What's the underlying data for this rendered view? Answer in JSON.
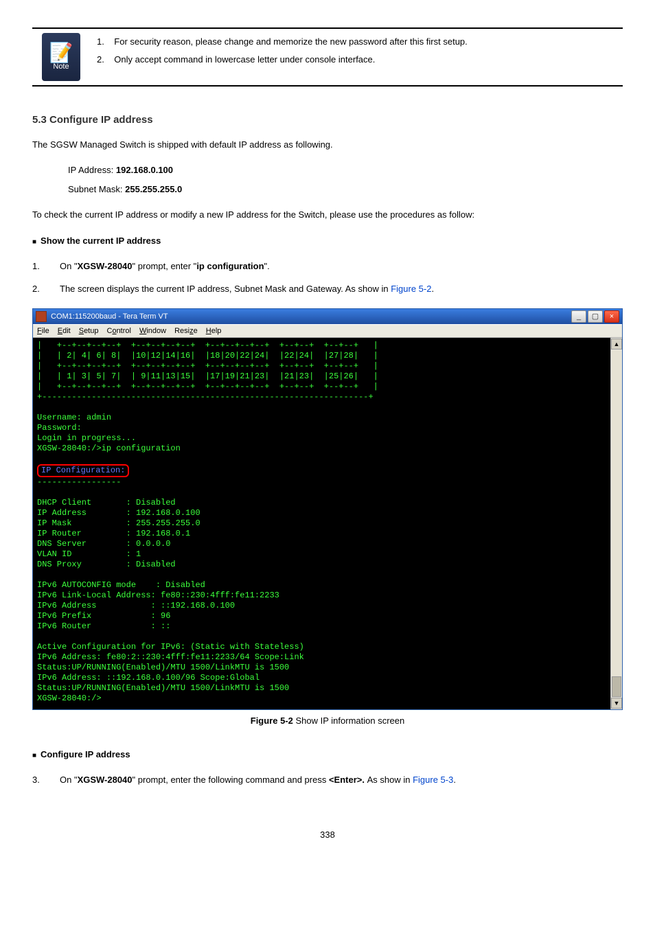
{
  "note": {
    "label": "Note",
    "item1_num": "1.",
    "item1_text": "For security reason, please change and memorize the new password after this first setup.",
    "item2_num": "2.",
    "item2_text": "Only accept command in lowercase letter under console interface."
  },
  "section1_title": "5.3 Configure IP address",
  "para1": "The SGSW Managed Switch is shipped with default IP address as following.",
  "ip_label": "IP Address:",
  "ip_value": "192.168.0.100",
  "mask_label": "Subnet Mask:",
  "mask_value": "255.255.255.0",
  "para2": "To check the current IP address or modify a new IP address for the Switch, please use the procedures as follow:",
  "sub1": "Show the current IP address",
  "step1": {
    "num": "1.",
    "a": "On \"",
    "b": "XGSW-28040",
    "c": "\" prompt, enter \"",
    "d": "ip configuration",
    "e": "\"."
  },
  "step2": {
    "num": "2.",
    "a": "The screen displays the current IP address, Subnet Mask and Gateway. As show in ",
    "link": "Figure 5-2",
    "b": "."
  },
  "terminal": {
    "title": "COM1:115200baud - Tera Term VT",
    "menus": {
      "file": "File",
      "edit": "Edit",
      "setup": "Setup",
      "control": "Control",
      "window": "Window",
      "resize": "Resize",
      "help": "Help"
    },
    "ascii_top": "|   +--+--+--+--+  +--+--+--+--+  +--+--+--+--+  +--+--+  +--+--+   |\n|   | 2| 4| 6| 8|  |10|12|14|16|  |18|20|22|24|  |22|24|  |27|28|   |\n|   +--+--+--+--+  +--+--+--+--+  +--+--+--+--+  +--+--+  +--+--+   |\n|   | 1| 3| 5| 7|  | 9|11|13|15|  |17|19|21|23|  |21|23|  |25|26|   |\n|   +--+--+--+--+  +--+--+--+--+  +--+--+--+--+  +--+--+  +--+--+   |\n+------------------------------------------------------------------+",
    "login": "Username: admin\nPassword:\nLogin in progress...\nXGSW-28040:/>ip configuration",
    "ip_cfg_label": "IP Configuration:",
    "body1": "DHCP Client       : Disabled\nIP Address        : 192.168.0.100\nIP Mask           : 255.255.255.0\nIP Router         : 192.168.0.1\nDNS Server        : 0.0.0.0\nVLAN ID           : 1\nDNS Proxy         : Disabled\n\nIPv6 AUTOCONFIG mode    : Disabled\nIPv6 Link-Local Address: fe80::230:4fff:fe11:2233\nIPv6 Address           : ::192.168.0.100\nIPv6 Prefix            : 96\nIPv6 Router            : ::\n\nActive Configuration for IPv6: (Static with Stateless)\nIPv6 Address: fe80:2::230:4fff:fe11:2233/64 Scope:Link\nStatus:UP/RUNNING(Enabled)/MTU 1500/LinkMTU is 1500\nIPv6 Address: ::192.168.0.100/96 Scope:Global\nStatus:UP/RUNNING(Enabled)/MTU 1500/LinkMTU is 1500\nXGSW-28040:/>"
  },
  "caption_a": "Figure 5-2 ",
  "caption_b": "Show IP information screen",
  "sub2": "Configure IP address",
  "step3": {
    "num": "3.",
    "a": "On \"",
    "b": "XGSW-28040",
    "c": "\" prompt, enter the following command and press ",
    "d": "<Enter>. ",
    "e": "As show in ",
    "link": "Figure 5-3",
    "f": "."
  },
  "page_num": "338"
}
